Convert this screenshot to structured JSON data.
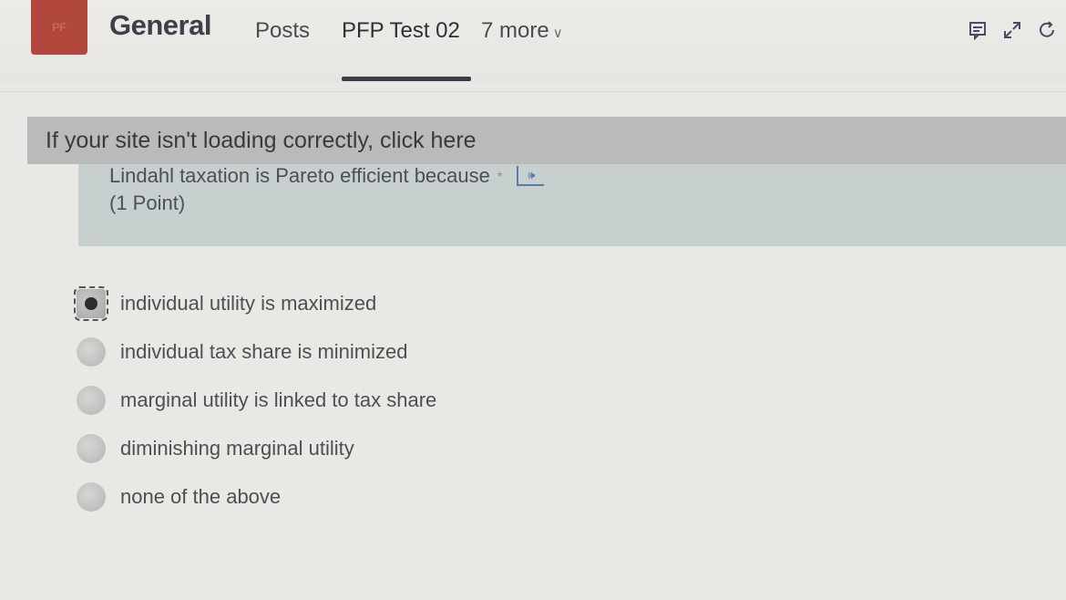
{
  "header": {
    "avatar_text": "PF",
    "channel_title": "General",
    "tabs": [
      {
        "label": "Posts"
      },
      {
        "label": "PFP Test 02"
      },
      {
        "label": "7 more"
      }
    ],
    "icons": [
      "conversation-icon",
      "expand-icon",
      "reload-icon"
    ]
  },
  "banner": {
    "text": "If your site isn't loading correctly, click here"
  },
  "question": {
    "text": "Lindahl taxation is Pareto efficient because",
    "required_mark": "*",
    "points": "(1 Point)"
  },
  "options": [
    {
      "label": "individual utility is maximized",
      "selected": true
    },
    {
      "label": "individual tax share is minimized",
      "selected": false
    },
    {
      "label": "marginal utility is linked to tax share",
      "selected": false
    },
    {
      "label": "diminishing marginal utility",
      "selected": false
    },
    {
      "label": "none of the above",
      "selected": false
    }
  ],
  "colors": {
    "avatar": "#b2473d",
    "banner": "#b9bbba",
    "question_block": "#c7cfcf"
  }
}
